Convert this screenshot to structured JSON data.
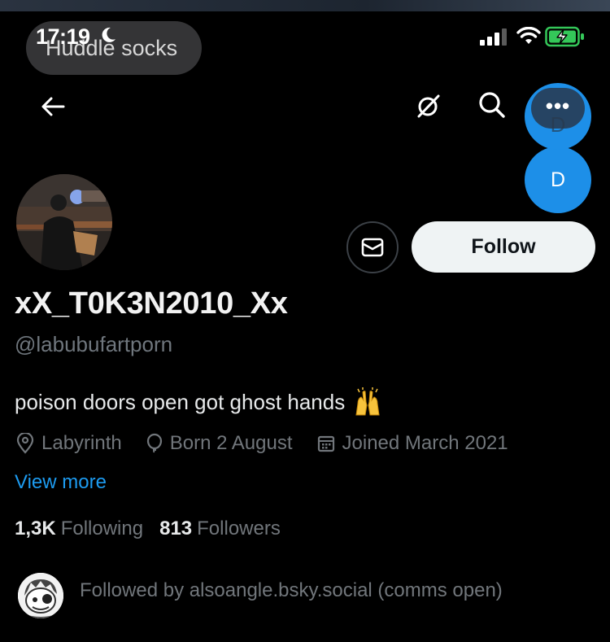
{
  "status_bar": {
    "time": "17:19",
    "notification": "Huddle socks"
  },
  "nav": {
    "back_icon": "arrow-left-icon",
    "grok_icon": "grok-icon",
    "search_icon": "search-icon",
    "more_label": "•••",
    "floating_avatar_letter": "D"
  },
  "profile": {
    "display_name": "xX_T0K3N2010_Xx",
    "handle": "@labubufartporn",
    "bio": "poison doors open got ghost hands",
    "bio_emoji": "raised-hands-emoji",
    "location": "Labyrinth",
    "birthday": "Born 2 August",
    "joined": "Joined March 2021",
    "view_more": "View more",
    "following_count": "1,3K",
    "following_label": "Following",
    "followers_count": "813",
    "followers_label": "Followers",
    "followed_by": "Followed by alsoangle.bsky.social (comms open)"
  },
  "actions": {
    "message_icon": "envelope-icon",
    "follow_label": "Follow"
  },
  "colors": {
    "background": "#000000",
    "accent": "#1d9bf0",
    "muted_text": "#71767b",
    "follow_button_bg": "#eff3f4",
    "floating_bubble": "#1d8fe8",
    "battery_green": "#34c759"
  }
}
